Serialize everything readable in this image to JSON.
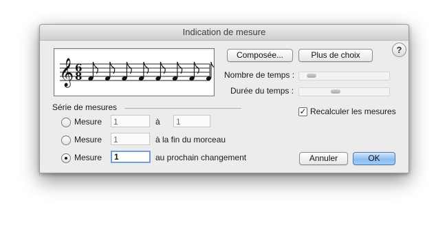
{
  "window": {
    "title": "Indication de mesure"
  },
  "preview": {
    "time_signature_top": "6",
    "time_signature_bottom": "8",
    "note_count": 8
  },
  "buttons": {
    "composee": "Composée...",
    "plus_de_choix": "Plus de choix",
    "annuler": "Annuler",
    "ok": "OK",
    "help": "?"
  },
  "sliders": {
    "nombre_de_temps_label": "Nombre de temps :",
    "duree_du_temps_label": "Durée du temps :"
  },
  "recalc": {
    "label": "Recalculer les mesures",
    "checked": true
  },
  "serie": {
    "group_label": "Série de mesures",
    "rows": [
      {
        "label": "Mesure",
        "value1": "1",
        "connector": "à",
        "value2": "1",
        "selected": false
      },
      {
        "label": "Mesure",
        "value1": "1",
        "connector": "à la fin du morceau",
        "selected": false
      },
      {
        "label": "Mesure",
        "value1": "1",
        "connector": "au prochain changement",
        "selected": true
      }
    ]
  },
  "colors": {
    "default_button": "#8cbcf0",
    "focus_ring": "#6d9fd8"
  }
}
